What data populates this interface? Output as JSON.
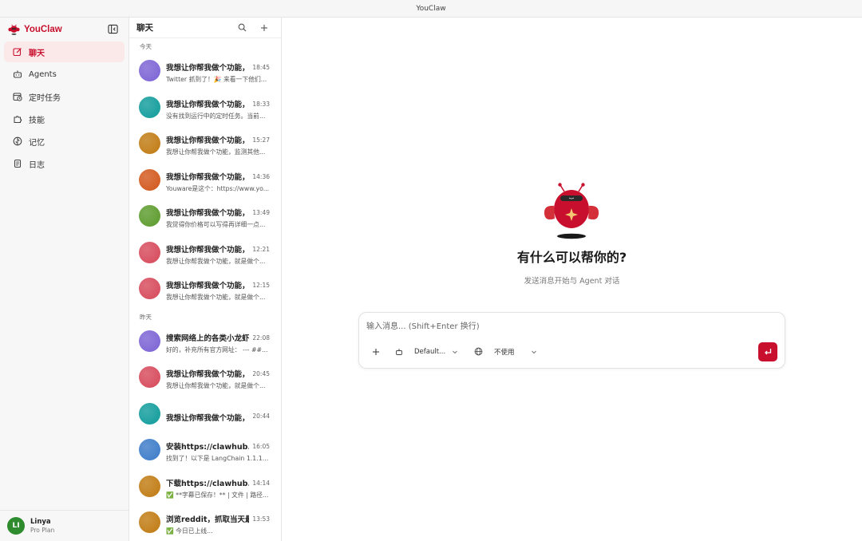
{
  "window": {
    "title": "YouClaw"
  },
  "brand": {
    "name": "YouClaw",
    "accent": "#c8102e"
  },
  "sidebar": {
    "items": [
      {
        "label": "聊天",
        "icon": "edit-icon",
        "active": true
      },
      {
        "label": "Agents",
        "icon": "robot-icon",
        "active": false
      },
      {
        "label": "定时任务",
        "icon": "calendar-clock-icon",
        "active": false
      },
      {
        "label": "技能",
        "icon": "puzzle-icon",
        "active": false
      },
      {
        "label": "记忆",
        "icon": "brain-icon",
        "active": false
      },
      {
        "label": "日志",
        "icon": "scroll-icon",
        "active": false
      }
    ]
  },
  "user": {
    "initials": "LI",
    "name": "Linya",
    "plan": "Pro Plan"
  },
  "chatlist": {
    "title": "聊天",
    "groups": [
      {
        "label": "今天",
        "items": [
          {
            "title": "我想让你帮我做个功能，",
            "time": "18:45",
            "preview": "Twitter 抓到了！🎉 来看一下他们...",
            "color": "#7b62d4"
          },
          {
            "title": "我想让你帮我做个功能，",
            "time": "18:33",
            "preview": "没有找到运行中的定时任务。当前...",
            "color": "#0f9b9b"
          },
          {
            "title": "我想让你帮我做个功能，",
            "time": "15:27",
            "preview": "我想让你帮我做个功能，监测其他...",
            "color": "#c07a10"
          },
          {
            "title": "我想让你帮我做个功能，",
            "time": "14:36",
            "preview": "Youware是这个：https://www.yo...",
            "color": "#d2561a"
          },
          {
            "title": "我想让你帮我做个功能，",
            "time": "13:49",
            "preview": "我觉得你价格可以写得再详细一点...",
            "color": "#5a9a2a"
          },
          {
            "title": "我想让你帮我做个功能，",
            "time": "12:21",
            "preview": "我想让你帮我做个功能，就是做个...",
            "color": "#d6485a"
          },
          {
            "title": "我想让你帮我做个功能，",
            "time": "12:15",
            "preview": "我想让你帮我做个功能，就是做个...",
            "color": "#d6485a"
          }
        ]
      },
      {
        "label": "昨天",
        "items": [
          {
            "title": "搜索网络上的各类小龙虾",
            "time": "22:08",
            "preview": "好的，补充所有官方网址： --- ##...",
            "color": "#7b62d4"
          },
          {
            "title": "我想让你帮我做个功能，",
            "time": "20:45",
            "preview": "我想让你帮我做个功能，就是做个...",
            "color": "#d6485a"
          },
          {
            "title": "我想让你帮我做个功能，",
            "time": "20:44",
            "preview": "",
            "color": "#0f9b9b"
          },
          {
            "title": "安装https://clawhub.ai/",
            "time": "16:05",
            "preview": "找到了！以下是 LangChain 1.1.12...",
            "color": "#3a7ac8"
          },
          {
            "title": "下载https://clawhub.ai/",
            "time": "14:14",
            "preview": "✅ **字幕已保存！** | 文件 | 路径...",
            "color": "#c07a10"
          },
          {
            "title": "浏览reddit，抓取当天最",
            "time": "13:53",
            "preview": "✅ 今日已上线...",
            "color": "#c07a10"
          }
        ]
      }
    ]
  },
  "main": {
    "hero_title": "有什么可以帮你的?",
    "hero_subtitle": "发送消息开始与 Agent 对话",
    "composer": {
      "placeholder": "输入消息... (Shift+Enter 换行)",
      "model_label": "Default...",
      "web_label": "不使用"
    }
  }
}
